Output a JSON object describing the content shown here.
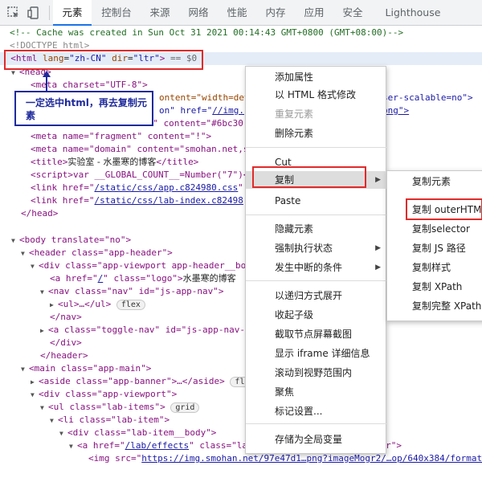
{
  "toolbar": {
    "tabs": [
      "元素",
      "控制台",
      "来源",
      "网络",
      "性能",
      "内存",
      "应用",
      "安全",
      "Lighthouse"
    ]
  },
  "code": {
    "comment": "<!-- Cache was created in Sun Oct 31 2021 00:14:43 GMT+0800 (GMT+08:00)-->",
    "doctype": "<!DOCTYPE html>",
    "html_tag": "html",
    "html_lang_attr": "lang",
    "html_lang_val": "\"zh-CN\"",
    "html_dir_attr": "dir",
    "html_dir_val": "\"ltr\"",
    "selected_marker": "== $0",
    "head_open": "<head>",
    "meta_charset": "<meta charset=\"UTF-8\">",
    "meta_viewport_tail": "ontent=\"width=devi",
    "meta_viewport_end": "ser-scalable=no\">",
    "line_on": "on\" href=\"",
    "line_on_link": "//img.",
    "line_on_end": "ong\">",
    "meta_theme": "<meta name=\"theme-color\" content=\"#6bc30",
    "meta_fragment": "<meta name=\"fragment\" content=\"!\">",
    "meta_domain": "<meta name=\"domain\" content=\"smohan.net,s",
    "title_open": "<title>",
    "title_text": "实验室 - 水墨寒的博客",
    "title_close": "</title>",
    "script_line": "<script>var __GLOBAL_COUNT__=Number(\"7\")<",
    "link1_pre": "<link href=\"",
    "link1_url": "/static/css/app.c824980.css",
    "link1_post": "\"",
    "link2_pre": "<link href=\"",
    "link2_url": "/static/css/lab-index.c82498",
    "head_close": "</head>",
    "body_open": "<body translate=\"no\">",
    "header_open": "<header class=\"app-header\">",
    "div_viewport": "<div class=\"app-viewport app-header__bo",
    "a_logo_pre": "<a href=\"",
    "a_logo_url": "/",
    "a_logo_post": "\" class=\"logo\">",
    "a_logo_text": "水墨寒的博客",
    "nav_line": "<nav class=\"nav\" id=\"js-app-nav\">",
    "ul_line": "<ul>…</ul>",
    "flex_pill": "flex",
    "nav_close": "</nav>",
    "a_toggle": "<a class=\"toggle-nav\" id=\"js-app-nav-",
    "div_close": "</div>",
    "header_close": "</header>",
    "main_open": "<main class=\"app-main\">",
    "aside_line": "<aside class=\"app-banner\">…</aside>",
    "aside_pill": "fle",
    "div_viewport2": "<div class=\"app-viewport\">",
    "ul_items": "<ul class=\"lab-items\">",
    "grid_pill": "grid",
    "li_item": "<li class=\"lab-item\">",
    "div_body": "<div class=\"lab-item__body\">",
    "a_effects_pre": "<a href=\"",
    "a_effects_url": "/lab/effects",
    "a_effects_post": "\" class=\"lab-item__thumbnail g-flicker\">",
    "img_pre": "<img src=\"",
    "img_url": "https://img.smohan.net/97e47d1…png?imageMogr2/…op/640x384/format"
  },
  "annotation": {
    "text": "一定选中html，再去复制元素"
  },
  "context_menu": {
    "items": [
      {
        "label": "添加属性"
      },
      {
        "label": "以 HTML 格式修改"
      },
      {
        "label": "重复元素"
      },
      {
        "label": "删除元素"
      },
      {
        "label": "Cut"
      },
      {
        "label": "复制"
      },
      {
        "label": "Paste"
      },
      {
        "label": "隐藏元素"
      },
      {
        "label": "强制执行状态"
      },
      {
        "label": "发生中断的条件"
      },
      {
        "label": "以递归方式展开"
      },
      {
        "label": "收起子级"
      },
      {
        "label": "截取节点屏幕截图"
      },
      {
        "label": "显示 iframe 详细信息"
      },
      {
        "label": "滚动到视野范围内"
      },
      {
        "label": "聚焦"
      },
      {
        "label": "标记设置..."
      },
      {
        "label": "存储为全局变量"
      }
    ],
    "arrow_glyph": "▶"
  },
  "copy_submenu": {
    "items": [
      {
        "label": "复制元素"
      },
      {
        "label": "复制 outerHTML"
      },
      {
        "label": "复制selector"
      },
      {
        "label": "复制 JS 路径"
      },
      {
        "label": "复制样式"
      },
      {
        "label": "复制 XPath"
      },
      {
        "label": "复制完整 XPath"
      }
    ]
  },
  "colors": {
    "highlight_red": "#e02b2b",
    "annotation_blue": "#1f2a9b",
    "selected_row": "#e4ecf7",
    "active_tab": "#1a73e8"
  }
}
